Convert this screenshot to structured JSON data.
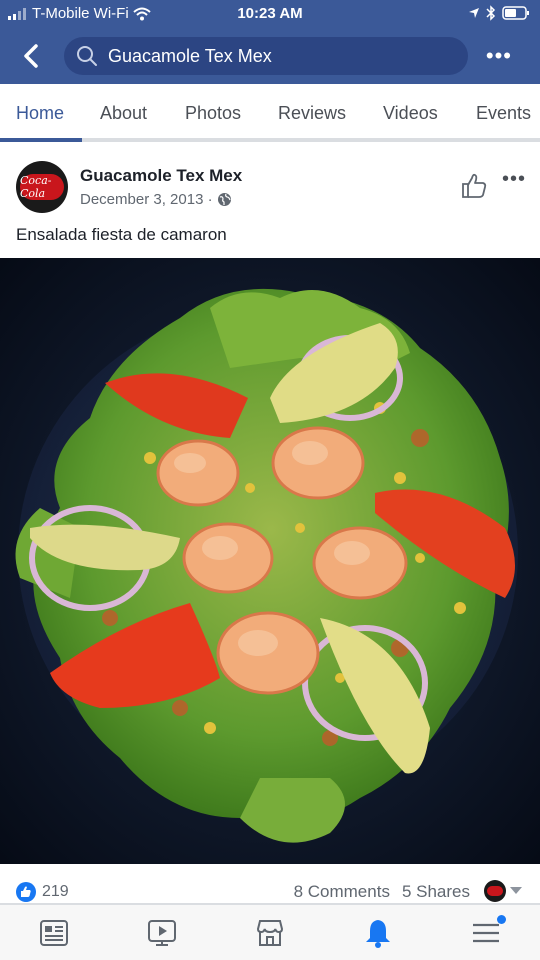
{
  "status": {
    "carrier": "T-Mobile Wi-Fi",
    "time": "10:23 AM"
  },
  "search": {
    "query": "Guacamole Tex Mex"
  },
  "tabs": [
    {
      "label": "Home",
      "active": true
    },
    {
      "label": "About"
    },
    {
      "label": "Photos"
    },
    {
      "label": "Reviews"
    },
    {
      "label": "Videos"
    },
    {
      "label": "Events"
    }
  ],
  "post": {
    "page_name": "Guacamole Tex Mex",
    "date": "December 3, 2013 ·",
    "privacy_icon": "globe-icon",
    "text": "Ensalada fiesta de camaron",
    "avatar_text": "Coca-Cola"
  },
  "footer": {
    "likes": "219",
    "comments": "8 Comments",
    "shares": "5 Shares"
  },
  "bottom_nav": [
    {
      "icon": "news-feed-icon"
    },
    {
      "icon": "watch-icon"
    },
    {
      "icon": "marketplace-icon"
    },
    {
      "icon": "notifications-icon",
      "active": true
    },
    {
      "icon": "menu-icon",
      "badge": true
    }
  ],
  "colors": {
    "brand": "#3b5998",
    "accent": "#1877f2",
    "text": "#1d2129",
    "muted": "#606770"
  }
}
